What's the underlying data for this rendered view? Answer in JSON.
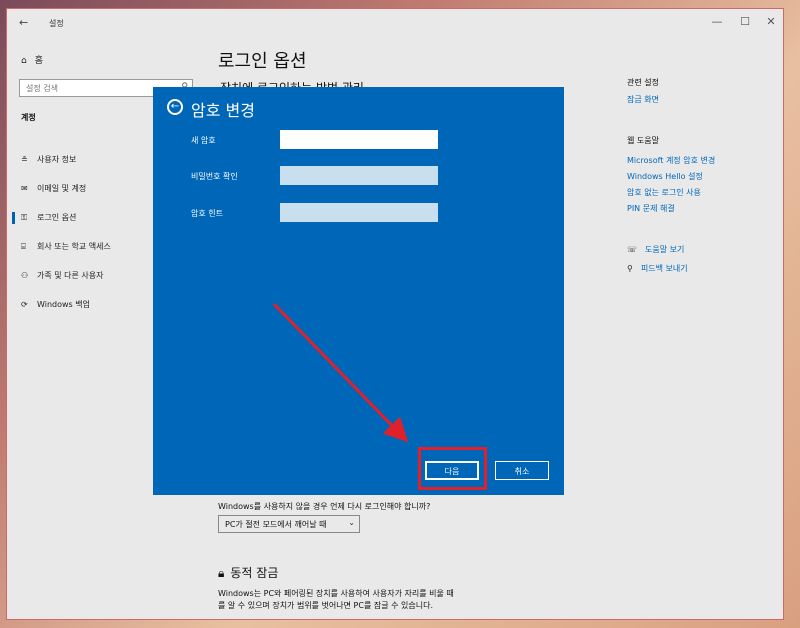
{
  "window": {
    "title": "설정",
    "controls": [
      "—",
      "☐",
      "✕"
    ]
  },
  "sidebar": {
    "home": "홈",
    "search_placeholder": "설정 검색",
    "section_title": "계정",
    "items": [
      {
        "label": "사용자 정보",
        "icon": "person-card-icon"
      },
      {
        "label": "이메일 및 계정",
        "icon": "mail-icon"
      },
      {
        "label": "로그인 옵션",
        "icon": "key-icon",
        "selected": true
      },
      {
        "label": "회사 또는 학교 액세스",
        "icon": "briefcase-icon"
      },
      {
        "label": "가족 및 다른 사용자",
        "icon": "people-icon"
      },
      {
        "label": "Windows 백업",
        "icon": "sync-icon"
      }
    ]
  },
  "main": {
    "title": "로그인 옵션",
    "subheading": "장치에 로그인하는 방법 관리",
    "question": "Windows를 사용하지 않을 경우 언제 다시 로그인해야 합니까?",
    "select_value": "PC가 절전 모드에서 깨어날 때",
    "dynamic_lock_title": "동적 잠금",
    "dynamic_lock_desc_1": "Windows는 PC와 페어링된 장치를 사용하여 사용자가 자리를 비울 때",
    "dynamic_lock_desc_2": "를 알 수 있으며 장치가 범위를 벗어나면 PC를 잠글 수 있습니다."
  },
  "right": {
    "related_heading": "관련 설정",
    "lock_screen": "잠금 화면",
    "help_heading": "웹 도움말",
    "links": [
      "Microsoft 계정 암호 변경",
      "Windows Hello 설정",
      "암호 없는 로그인 사용",
      "PIN 문제 해결"
    ],
    "get_help": "도움말 보기",
    "feedback": "피드백 보내기"
  },
  "dialog": {
    "title": "암호 변경",
    "new_password_label": "새 암호",
    "confirm_password_label": "비밀번호 확인",
    "hint_label": "암호 힌트",
    "new_password_value": "",
    "confirm_password_value": "",
    "hint_value": "",
    "next_button": "다음",
    "cancel_button": "취소"
  },
  "colors": {
    "dialog_bg": "#0067b8",
    "link": "#0067b8",
    "highlight": "#e0202a"
  }
}
